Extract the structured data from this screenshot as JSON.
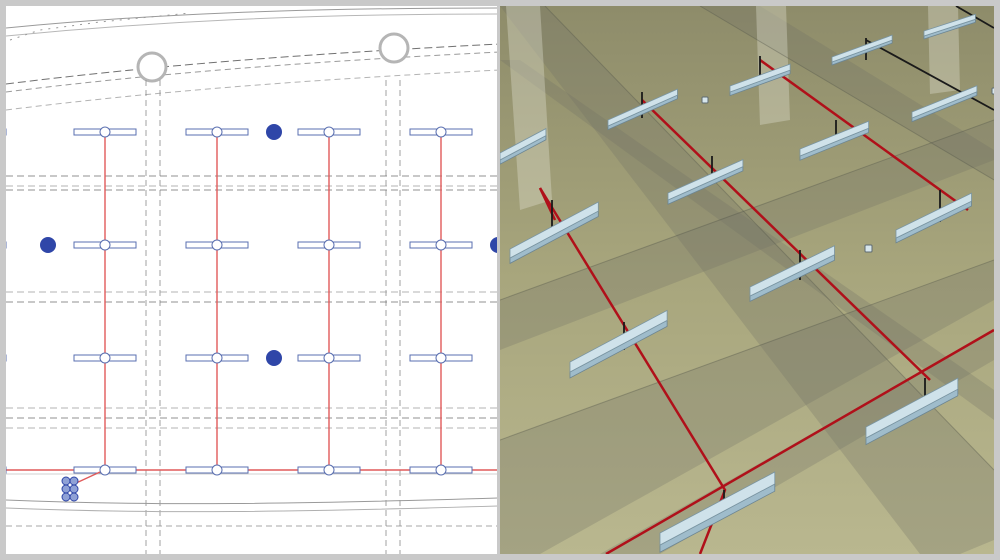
{
  "figure": {
    "frame_color": "#c9c9c9",
    "plan_view": {
      "background": "#ffffff",
      "grid_line_color": "#8a8a8a",
      "pipe_color": "#e05a5a",
      "fixture_outline": "#5a6fb0",
      "sprinkler_color": "#2f46a8",
      "column_rows": 4,
      "column_cols": 5,
      "bubble_count": 2
    },
    "model_view": {
      "ceiling_color": "#a9a67a",
      "beam_color": "#7d7f6e",
      "pipe_color": "#b0101a",
      "hanger_color": "#1a1a1a",
      "fixture_color": "#cfe2ea"
    }
  }
}
